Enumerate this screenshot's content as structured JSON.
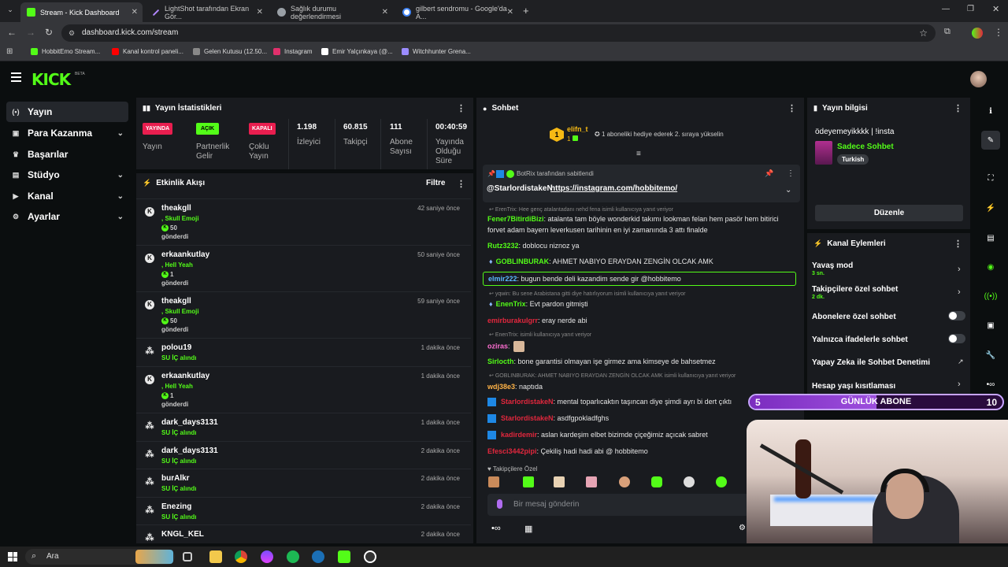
{
  "browser": {
    "tabs": [
      {
        "title": "Stream - Kick Dashboard",
        "active": true,
        "color": "#53fc18"
      },
      {
        "title": "LightShot tarafından Ekran Gör...",
        "active": false,
        "color": "#b388ff"
      },
      {
        "title": "Sağlık durumu değerlendirmesi",
        "active": false,
        "color": "#9aa0a6"
      },
      {
        "title": "gilbert sendromu - Google'da A...",
        "active": false,
        "color": "#4285f4"
      }
    ],
    "url": "dashboard.kick.com/stream",
    "bookmarks": [
      {
        "label": "HobbitEmo Stream...",
        "color": "#53fc18"
      },
      {
        "label": "Kanal kontrol paneli...",
        "color": "#ff0000"
      },
      {
        "label": "Gelen Kutusu (12.50...",
        "color": "#888888"
      },
      {
        "label": "Instagram",
        "color": "#e1306c"
      },
      {
        "label": "Emir Yalçınkaya (@...",
        "color": "#ffffff"
      },
      {
        "label": "Witchhunter Grena...",
        "color": "#9b8cff"
      }
    ]
  },
  "kick": {
    "logo": "KICK",
    "beta": "BETA"
  },
  "nav": [
    {
      "label": "Yayın",
      "icon": "broadcast-icon",
      "glyph": "(•)",
      "active": true,
      "chevron": false
    },
    {
      "label": "Para Kazanma",
      "icon": "money-icon",
      "glyph": "▣",
      "active": false,
      "chevron": true
    },
    {
      "label": "Başarılar",
      "icon": "trophy-icon",
      "glyph": "🏆",
      "active": false,
      "chevron": false
    },
    {
      "label": "Stüdyo",
      "icon": "studio-icon",
      "glyph": "▤",
      "active": false,
      "chevron": true
    },
    {
      "label": "Kanal",
      "icon": "channel-icon",
      "glyph": "▶",
      "active": false,
      "chevron": true
    },
    {
      "label": "Ayarlar",
      "icon": "settings-icon",
      "glyph": "⚙",
      "active": false,
      "chevron": true
    }
  ],
  "stats": {
    "title": "Yayın İstatistikleri",
    "cells": [
      {
        "pill": "YAYINDA",
        "label": "Yayın",
        "pill_bg": "#e91e4f",
        "pill_fg": "#ffffff"
      },
      {
        "pill": "AÇIK",
        "label": "Partnerlik Gelir",
        "pill_bg": "#53fc18",
        "pill_fg": "#000000"
      },
      {
        "pill": "KAPALI",
        "label": "Çoklu Yayın",
        "pill_bg": "#e91e4f",
        "pill_fg": "#ffffff"
      }
    ],
    "values": [
      {
        "value": "1.198",
        "label": "İzleyici"
      },
      {
        "value": "60.815",
        "label": "Takipçi"
      },
      {
        "value": "111",
        "label": "Abone Sayısı"
      },
      {
        "value": "00:40:59",
        "label": "Yayında Olduğu Süre"
      }
    ]
  },
  "activity": {
    "title": "Etkinlik Akışı",
    "filter": "Filtre",
    "events": [
      {
        "user": "theakgll",
        "detail": ", Skull Emoji",
        "amount": "50",
        "sent": "gönderdi",
        "time": "42 saniye önce",
        "kind": "kick"
      },
      {
        "user": "erkaankutlay",
        "detail": ", Hell Yeah",
        "amount": "1",
        "sent": "gönderdi",
        "time": "50 saniye önce",
        "kind": "kick"
      },
      {
        "user": "theakgll",
        "detail": ", Skull Emoji",
        "amount": "50",
        "sent": "gönderdi",
        "time": "59 saniye önce",
        "kind": "kick"
      },
      {
        "user": "polou19",
        "detail": "SU İÇ alındı",
        "time": "1 dakika önce",
        "kind": "reward"
      },
      {
        "user": "erkaankutlay",
        "detail": ", Hell Yeah",
        "amount": "1",
        "sent": "gönderdi",
        "time": "1 dakika önce",
        "kind": "kick"
      },
      {
        "user": "dark_days3131",
        "detail": "SU İÇ alındı",
        "time": "1 dakika önce",
        "kind": "reward"
      },
      {
        "user": "dark_days3131",
        "detail": "SU İÇ alındı",
        "time": "2 dakika önce",
        "kind": "reward"
      },
      {
        "user": "burAlkr",
        "detail": "SU İÇ alındı",
        "time": "2 dakika önce",
        "kind": "reward"
      },
      {
        "user": "Enezing",
        "detail": "SU İÇ alındı",
        "time": "2 dakika önce",
        "kind": "reward"
      },
      {
        "user": "KNGL_KEL",
        "detail": "",
        "time": "2 dakika önce",
        "kind": "reward"
      }
    ]
  },
  "chat": {
    "title": "Sohbet",
    "gifter": "elifn_t",
    "gifter_badge": "1",
    "gift_text": "1 aboneliki hediye ederek 2. sıraya yükselin",
    "pinned_by": "BotRix tarafından sabitlendi",
    "pinned_user": "@StarlordistakeN",
    "pinned_link": "https://instagram.com/hobbitemo/",
    "messages": [
      {
        "reply": "ErenTrix: Hee genç atalantadanı nehd fena isimli kullanıcıya yanıt veriyor"
      },
      {
        "user": "Fener7BitirdiBizi",
        "color": "#53fc18",
        "text": ": atalanta tam böyle wonderkid takımı lookman felan hem pasör hem bitirici"
      },
      {
        "text2": "forvet adam bayern leverkusen tarihinin en iyi zamanında 3 attı finalde"
      },
      {
        "user": "Rutz3232",
        "color": "#53fc18",
        "text": ": doblocu niznoz ya"
      },
      {
        "user": "GOBLINBURAK",
        "color": "#53fc18",
        "text": ": AHMET NABIYO ERAYDAN ZENGİN OLCAK AMK"
      },
      {
        "user": "elmir222",
        "color": "#5bb6ff",
        "text": ": bugun bende deli kazandim sende gir @hobbitemo",
        "highlight": true
      },
      {
        "reply": "yqwin: Bu sene Arabistana gitti diye hatırlıyorum isimli kullanıcıya yanıt veriyor"
      },
      {
        "user": "EnenTrix",
        "color": "#53fc18",
        "text": ": Evt pardon gitmişti"
      },
      {
        "user": "emirburakulgrr",
        "color": "#e2273d",
        "text": ": eray nerde abi"
      },
      {
        "reply": "EnenTrix: isimli kullanıcıya yanıt veriyor"
      },
      {
        "user": "oziras",
        "color": "#ff6fd2",
        "text": ":"
      },
      {
        "user": "Sirlocth",
        "color": "#53fc18",
        "text": ": bone garantisi olmayan işe girmez ama kimseye de bahsetmez"
      },
      {
        "reply": "GOBLINBURAK: AHMET NABIYO ERAYDAN ZENGİN OLCAK AMK isimli kullanıcıya yanıt veriyor"
      },
      {
        "user": "wdj38e3",
        "color": "#ffb347",
        "text": ": naptıda"
      },
      {
        "user": "StarlordistakeN",
        "color": "#e2273d",
        "text": ": mental toparlıcaktın taşıncan diye şimdi ayrı bi dert çıktı"
      },
      {
        "user": "StarlordistakeN",
        "color": "#e2273d",
        "text": ": asdfgpokladfghs"
      },
      {
        "user": "kadirdemir",
        "color": "#e2273d",
        "text": ": aslan kardeşim elbet bizimde çiçeğimiz açıcak sabret"
      },
      {
        "user": "Efesci3442pipi",
        "color": "#e2273d",
        "text": ": Çekiliş hadi hadi abi @ hobbitemo"
      }
    ],
    "follower_only": "Takipçilere Özel",
    "input_placeholder": "Bir mesaj gönderin"
  },
  "stream_info": {
    "title": "Yayın bilgisi",
    "stream_title": "ödeyemeyikkkk | !insta",
    "category": "Sadece Sohbet",
    "language": "Turkish",
    "edit": "Düzenle"
  },
  "channel_actions": {
    "title": "Kanal Eylemleri",
    "items": [
      {
        "label": "Yavaş mod",
        "sub": "3 sn.",
        "control": "chevron"
      },
      {
        "label": "Takipçilere özel sohbet",
        "sub": "2 dk.",
        "control": "chevron"
      },
      {
        "label": "Abonelere özel sohbet",
        "sub": "",
        "control": "toggle"
      },
      {
        "label": "Yalnızca ifadelerle sohbet",
        "sub": "",
        "control": "toggle"
      },
      {
        "label": "Yapay Zeka ile Sohbet Denetimi",
        "sub": "",
        "control": "external"
      },
      {
        "label": "Hesap yaşı kısıtlaması",
        "sub": "",
        "control": "chevron"
      }
    ]
  },
  "overlay": {
    "left_num": "5",
    "label": "GÜNLÜK ABONE",
    "right_num": "10",
    "progress": 0.5
  },
  "taskbar": {
    "search": "Ara"
  }
}
